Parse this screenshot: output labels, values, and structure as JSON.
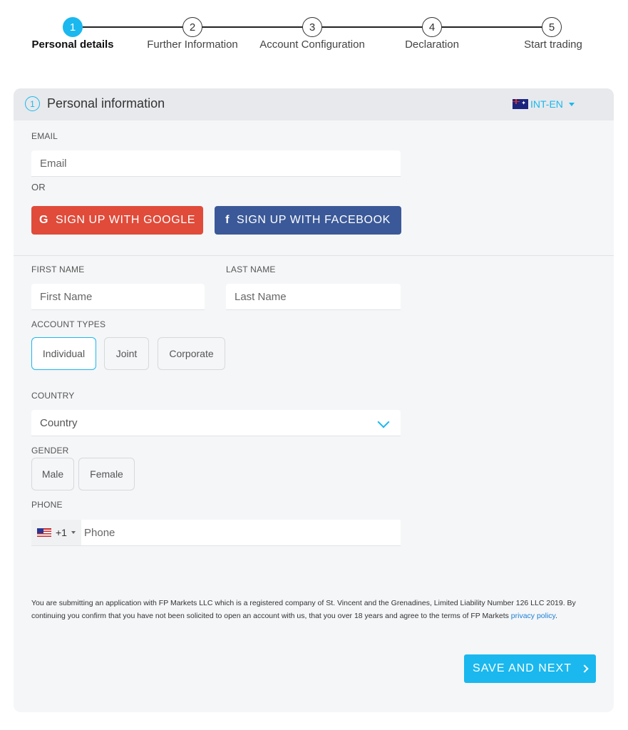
{
  "stepper": {
    "steps": [
      {
        "number": "1",
        "label": "Personal details"
      },
      {
        "number": "2",
        "label": "Further Information"
      },
      {
        "number": "3",
        "label": "Account Configuration"
      },
      {
        "number": "4",
        "label": "Declaration"
      },
      {
        "number": "5",
        "label": "Start trading"
      }
    ],
    "active_step": 1
  },
  "header": {
    "number": "1",
    "title": "Personal information",
    "language": "INT-EN",
    "language_flag_icon": "australia-flag-icon"
  },
  "email": {
    "label": "EMAIL",
    "placeholder": "Email",
    "or_text": "OR"
  },
  "social": {
    "google_icon": "G",
    "google_label": "SIGN UP WITH GOOGLE",
    "facebook_icon": "f",
    "facebook_label": "SIGN UP WITH FACEBOOK"
  },
  "name": {
    "first_label": "FIRST NAME",
    "first_placeholder": "First Name",
    "last_label": "LAST NAME",
    "last_placeholder": "Last Name"
  },
  "account_types": {
    "label": "ACCOUNT TYPES",
    "options": [
      "Individual",
      "Joint",
      "Corporate"
    ],
    "selected": "Individual"
  },
  "country": {
    "label": "COUNTRY",
    "value": "Country"
  },
  "gender": {
    "label": "GENDER",
    "options": [
      "Male",
      "Female"
    ]
  },
  "phone": {
    "label": "PHONE",
    "country_code": "+1",
    "flag_icon": "us-flag-icon",
    "placeholder": "Phone"
  },
  "legal": {
    "text": "You are submitting an application with FP Markets LLC which is a registered company of St. Vincent and the Grenadines, Limited Liability Number 126 LLC 2019. By continuing you confirm that you have not been solicited to open an account with us, that you over 18 years and agree to the terms of FP Markets ",
    "link": "privacy policy",
    "end": "."
  },
  "actions": {
    "save_next": "SAVE AND NEXT"
  },
  "colors": {
    "accent": "#1ab8ee",
    "google": "#e04b3a",
    "facebook": "#3b5998"
  }
}
